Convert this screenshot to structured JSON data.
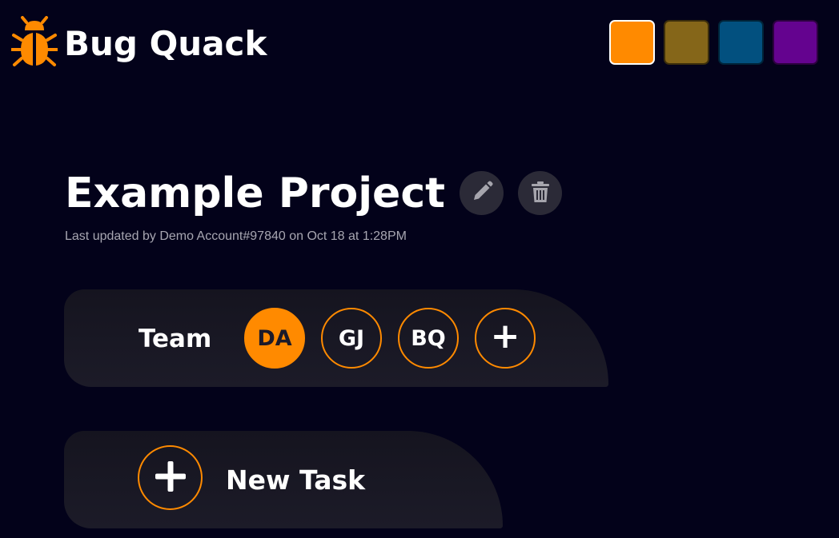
{
  "app": {
    "name": "Bug Quack",
    "logo_icon": "bug-icon",
    "accent_color": "#ff8a00"
  },
  "theme_swatches": [
    {
      "color": "#ff8a00",
      "selected": true
    },
    {
      "color": "#856619",
      "selected": false
    },
    {
      "color": "#02507f",
      "selected": false
    },
    {
      "color": "#64038f",
      "selected": false
    }
  ],
  "project": {
    "title": "Example Project",
    "edit_icon": "pencil-icon",
    "delete_icon": "trash-icon",
    "last_updated": "Last updated by Demo Account#97840 on Oct 18 at 1:28PM"
  },
  "team": {
    "label": "Team",
    "members": [
      {
        "initials": "DA",
        "active": true
      },
      {
        "initials": "GJ",
        "active": false
      },
      {
        "initials": "BQ",
        "active": false
      }
    ],
    "add_label": "+"
  },
  "tasks": {
    "new_task_label": "New Task",
    "new_task_icon": "plus-icon"
  }
}
